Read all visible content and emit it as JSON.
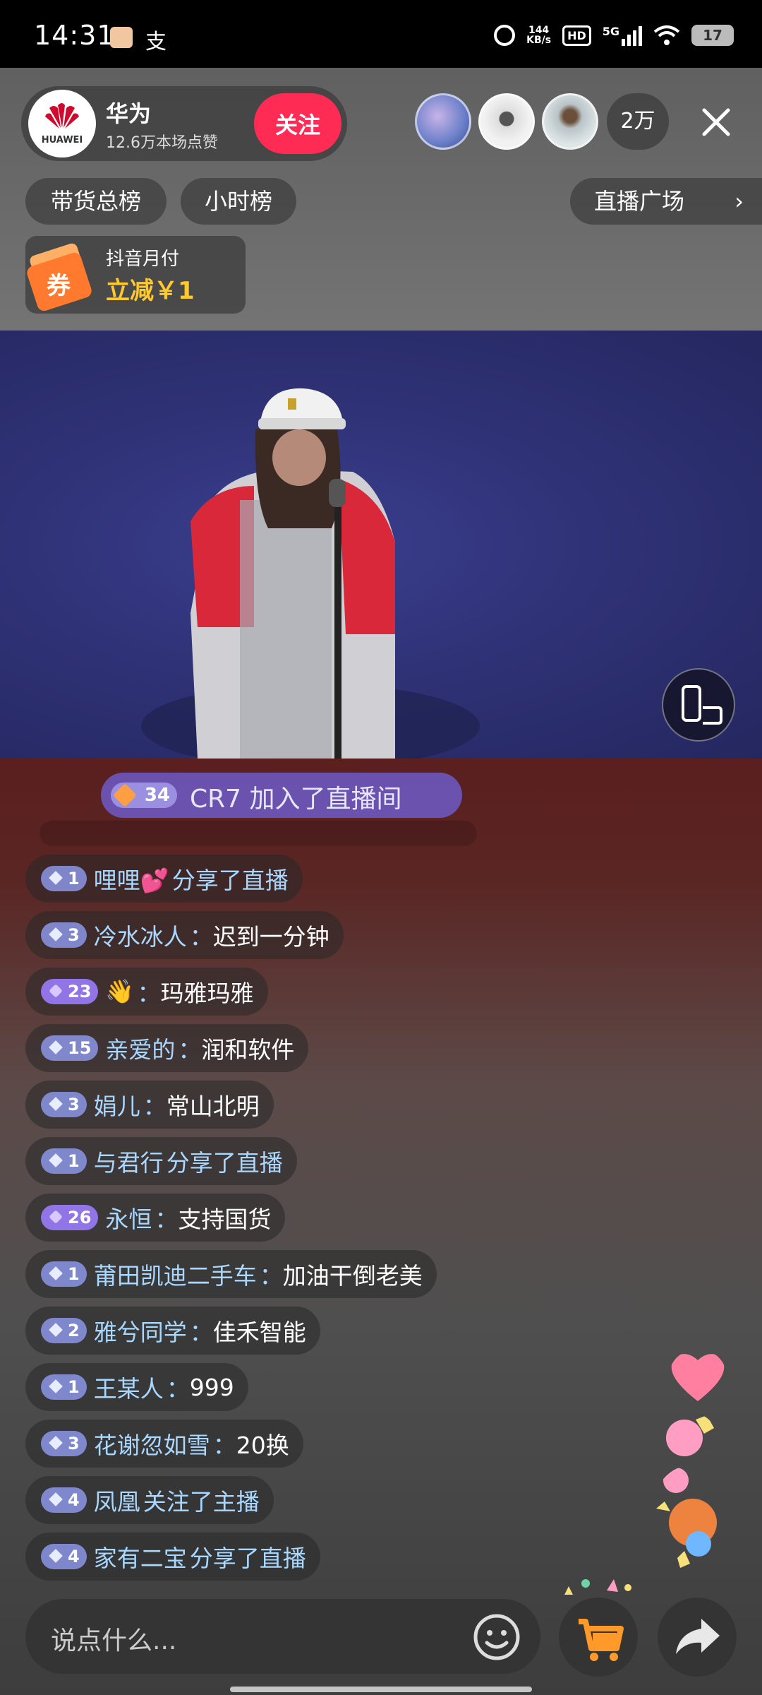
{
  "status_bar": {
    "time": "14:31",
    "app_icon_2": "支",
    "net_speed_top": "144",
    "net_speed_unit": "KB/s",
    "hd": "HD",
    "network": "5G",
    "battery": "17"
  },
  "header": {
    "anchor_name": "华为",
    "logo_text": "HUAWEI",
    "anchor_likes": "12.6万本场点赞",
    "follow_label": "关注",
    "viewer_count": "2万"
  },
  "rank_tabs": {
    "sales_rank": "带货总榜",
    "hourly_rank": "小时榜",
    "plaza": "直播广场"
  },
  "coupon": {
    "icon_text": "券",
    "title": "抖音月付",
    "discount": "立减￥1"
  },
  "join_notice": {
    "level": "34",
    "text": "CR7 加入了直播间"
  },
  "comments": [
    {
      "level": "1",
      "badge": "blue",
      "user": "哩哩💕",
      "sep": " ",
      "text": "分享了直播",
      "text_color": "#a8d8ff"
    },
    {
      "level": "3",
      "badge": "blue",
      "user": "冷水冰人",
      "sep": "：",
      "text": "迟到一分钟"
    },
    {
      "level": "23",
      "badge": "purple",
      "user": "👋",
      "sep": "：",
      "text": "玛雅玛雅"
    },
    {
      "level": "15",
      "badge": "blue",
      "user": "亲爱的",
      "sep": "：",
      "text": "润和软件"
    },
    {
      "level": "3",
      "badge": "blue",
      "user": "娟儿",
      "sep": "：",
      "text": "常山北明"
    },
    {
      "level": "1",
      "badge": "blue",
      "user": "与君行",
      "sep": " ",
      "text": "分享了直播",
      "text_color": "#a8d8ff"
    },
    {
      "level": "26",
      "badge": "purple",
      "user": "永恒",
      "sep": "：",
      "text": "支持国货"
    },
    {
      "level": "1",
      "badge": "blue",
      "user": "莆田凯迪二手车",
      "sep": "：",
      "text": "加油干倒老美"
    },
    {
      "level": "2",
      "badge": "blue",
      "user": "雅兮同学",
      "sep": "：",
      "text": "佳禾智能"
    },
    {
      "level": "1",
      "badge": "blue",
      "user": "王某人",
      "sep": "：",
      "text": "999"
    },
    {
      "level": "3",
      "badge": "blue",
      "user": "花谢忽如雪",
      "sep": "：",
      "text": "20换"
    },
    {
      "level": "4",
      "badge": "blue",
      "user": "凤凰",
      "sep": " ",
      "text": "关注了主播",
      "text_color": "#a8d8ff"
    },
    {
      "level": "4",
      "badge": "blue",
      "user": "家有二宝",
      "sep": " ",
      "text": "分享了直播",
      "text_color": "#a8d8ff"
    }
  ],
  "bottom_bar": {
    "input_placeholder": "说点什么..."
  },
  "colors": {
    "follow": "#fe2c55",
    "coupon_text": "#ffc92b",
    "username": "#a8d8ff"
  }
}
